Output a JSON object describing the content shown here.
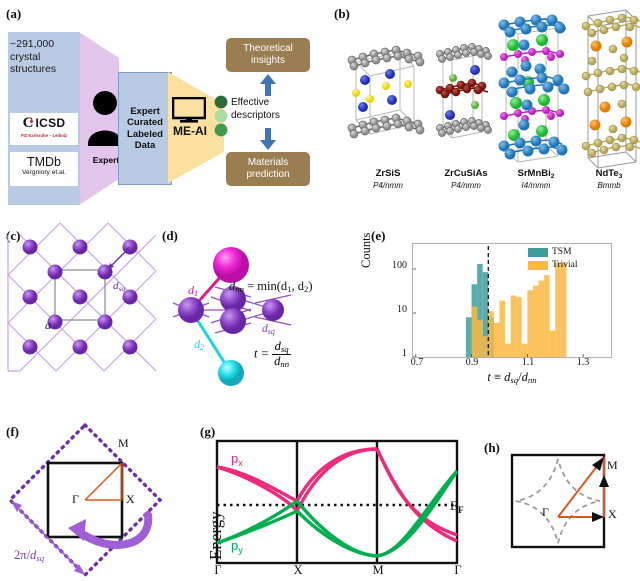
{
  "figure": {
    "panel_labels": {
      "a": "(a)",
      "b": "(b)",
      "c": "(c)",
      "d": "(d)",
      "e": "(e)",
      "f": "(f)",
      "g": "(g)",
      "h": "(h)"
    }
  },
  "panel_a": {
    "database_text": "~291,000 crystal structures",
    "logo_icsd": {
      "name": "ICSD",
      "subtitle": "FIZ Karlsruhe – Leibniz"
    },
    "logo_tmdb": {
      "name": "TMDb",
      "subtitle": "Vergniory et.al."
    },
    "expert_label": "Expert",
    "curated_label": "Expert Curated Labeled Data",
    "model_label": "ME-AI",
    "descriptors_label": "Effective descriptors",
    "output_top": "Theoretical insights",
    "output_bottom": "Materials prediction",
    "colors": {
      "data_box": "#b9cbe4",
      "expert_funnel": "#e3c5ec",
      "model_funnel": "#fae1a0",
      "output_box": "#9b7d52",
      "arrow": "#3f76b8",
      "descriptor_dark": "#2e6b36",
      "descriptor_light": "#a9dda3",
      "descriptor_mid": "#3f9a4b"
    }
  },
  "panel_b": {
    "structures": [
      {
        "name": "ZrSiS",
        "formula_base": "ZrSiS",
        "formula_sub": "",
        "space_group": "P4/nmm"
      },
      {
        "name": "ZrCuSiAs",
        "formula_base": "ZrCuSiAs",
        "formula_sub": "",
        "space_group": "P4/nmm"
      },
      {
        "name": "SrMnBi2",
        "formula_base": "SrMnBi",
        "formula_sub": "2",
        "space_group": "I4/mmm"
      },
      {
        "name": "NdTe3",
        "formula_base": "NdTe",
        "formula_sub": "3",
        "space_group": "Bmmb"
      }
    ],
    "atom_colors": {
      "grey": "#9d9d9d",
      "blue": "#2a3fc4",
      "yellow": "#f5e400",
      "darkred": "#8c1b14",
      "green": "#6cbf4a",
      "cyan_blue": "#2e86c9",
      "bright_green": "#2ecb3f",
      "magenta": "#d02bd0",
      "gold": "#f0920e",
      "khaki": "#c9bb6e"
    }
  },
  "panel_c": {
    "lattice_label": "a",
    "dsq_label": "d_sq",
    "dsq_sub": "sq",
    "atom_color": "#7e3fb8",
    "bond_color": "#c7a5e8"
  },
  "panel_d": {
    "eq_dnn_lhs": "d",
    "eq_dnn_lhs_sub": "nn",
    "eq_dnn_rhs": "= min(d",
    "eq_dnn_sub1": "1",
    "eq_dnn_mid": ", d",
    "eq_dnn_sub2": "2",
    "eq_dnn_close": ")",
    "label_d1": "d",
    "label_d1_sub": "1",
    "label_d2": "d",
    "label_d2_sub": "2",
    "label_dsq": "d",
    "label_dsq_sub": "sq",
    "t_lhs": "t =",
    "t_num": "d",
    "t_num_sub": "sq",
    "t_den": "d",
    "t_den_sub": "nn",
    "colors": {
      "d1": "#e6198c",
      "d2": "#16d6e8",
      "dsq": "#7e3fb8",
      "atom": "#7e3fb8",
      "magenta_atom": "#e016c6",
      "cyan_atom": "#1ad6e8"
    }
  },
  "chart_data": {
    "type": "bar",
    "title": "",
    "xlabel": "t ≡ d_sq/d_nn",
    "xlabel_parts": {
      "t": "t",
      "equiv": "≡",
      "num": "d",
      "num_sub": "sq",
      "slash": "/",
      "den": "d",
      "den_sub": "nn"
    },
    "ylabel": "Counts",
    "yscale": "log",
    "yticks": [
      1,
      10,
      100
    ],
    "ytick_labels": [
      "1",
      "10",
      "100"
    ],
    "ylim": [
      1,
      300
    ],
    "xticks": [
      0.7,
      0.9,
      1.1,
      1.3
    ],
    "xtick_labels": [
      "0.7",
      "0.9",
      "1.1",
      "1.3"
    ],
    "xlim": [
      0.69,
      1.4
    ],
    "bin_width": 0.02,
    "threshold_line": 0.96,
    "threshold_style": "dashed",
    "grid": false,
    "legend_position": "top-right",
    "series": [
      {
        "name": "TSM",
        "color": "#3d9c9c",
        "bins": [
          0.78,
          0.8,
          0.84,
          0.86,
          0.88,
          0.9,
          0.92,
          0.94,
          0.96,
          1.36
        ],
        "values": [
          1,
          1,
          1,
          1,
          8,
          45,
          130,
          85,
          8,
          1
        ]
      },
      {
        "name": "Trivial",
        "color": "#fbb93f",
        "bins": [
          0.9,
          0.92,
          0.94,
          0.96,
          0.98,
          1.0,
          1.02,
          1.04,
          1.06,
          1.08,
          1.1,
          1.12,
          1.14,
          1.16,
          1.18,
          1.2,
          1.22,
          1.24
        ],
        "values": [
          14,
          7,
          3,
          11,
          6,
          19,
          2,
          25,
          23,
          2,
          33,
          42,
          55,
          72,
          4,
          140,
          140,
          1
        ]
      }
    ],
    "legend": [
      {
        "label": "TSM",
        "color": "#3d9c9c"
      },
      {
        "label": "Trivial",
        "color": "#fbb93f"
      }
    ]
  },
  "panel_f": {
    "point_gamma": "Γ",
    "point_x": "X",
    "point_m": "M",
    "bz_label_num": "2π",
    "bz_label_den": "d",
    "bz_label_den_sub": "sq",
    "bz_label": "2π/d_sq",
    "colors": {
      "outer_bz": "#6c2fae",
      "inner_bz": "#111111",
      "path": "#e0561f",
      "arrow": "#a05fd6"
    }
  },
  "panel_g": {
    "ylabel": "Energy",
    "xticks": [
      "Γ",
      "X",
      "M",
      "Γ"
    ],
    "band_px_label": "p",
    "band_px_sub": "x",
    "band_py_label": "p",
    "band_py_sub": "y",
    "fermi_label": "E",
    "fermi_sub": "F",
    "colors": {
      "px": "#ee2a7b",
      "py": "#00b050",
      "fermi": "#000000"
    }
  },
  "panel_h": {
    "point_gamma": "Γ",
    "point_x": "X",
    "point_m": "M",
    "colors": {
      "box": "#111111",
      "fermi_surface": "#9a9a9a",
      "path": "#e0561f"
    }
  }
}
